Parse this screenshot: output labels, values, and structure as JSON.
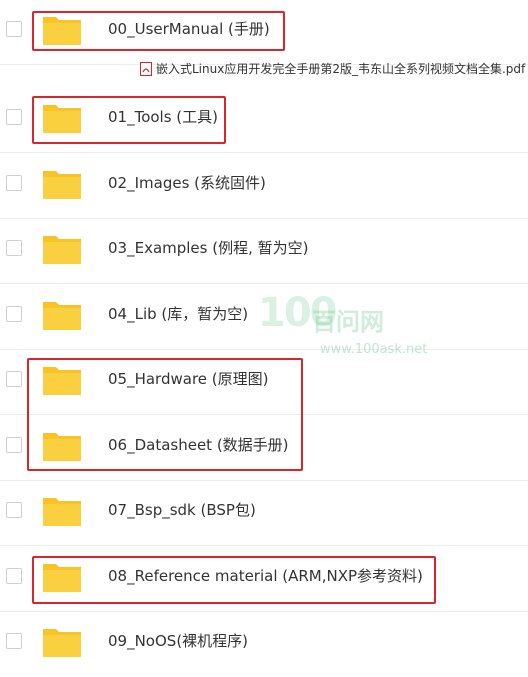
{
  "folders": [
    {
      "label": "00_UserManual (手册)"
    },
    {
      "label": "01_Tools (工具)"
    },
    {
      "label": "02_Images (系统固件)"
    },
    {
      "label": "03_Examples (例程, 暂为空)"
    },
    {
      "label": "04_Lib (库，暂为空)"
    },
    {
      "label": "05_Hardware (原理图)"
    },
    {
      "label": "06_Datasheet (数据手册)"
    },
    {
      "label": "07_Bsp_sdk (BSP包)"
    },
    {
      "label": "08_Reference material (ARM,NXP参考资料)"
    },
    {
      "label": "09_NoOS(裸机程序)"
    }
  ],
  "pdf_file": {
    "name": "嵌入式Linux应用开发完全手册第2版_韦东山全系列视频文档全集.pdf",
    "icon": "pdf-icon"
  },
  "watermark": {
    "logo_text": "100",
    "cn_text": "百问网",
    "url": "www.100ask.net"
  },
  "colors": {
    "folder": "#f7c325",
    "highlight": "#d8262d"
  }
}
